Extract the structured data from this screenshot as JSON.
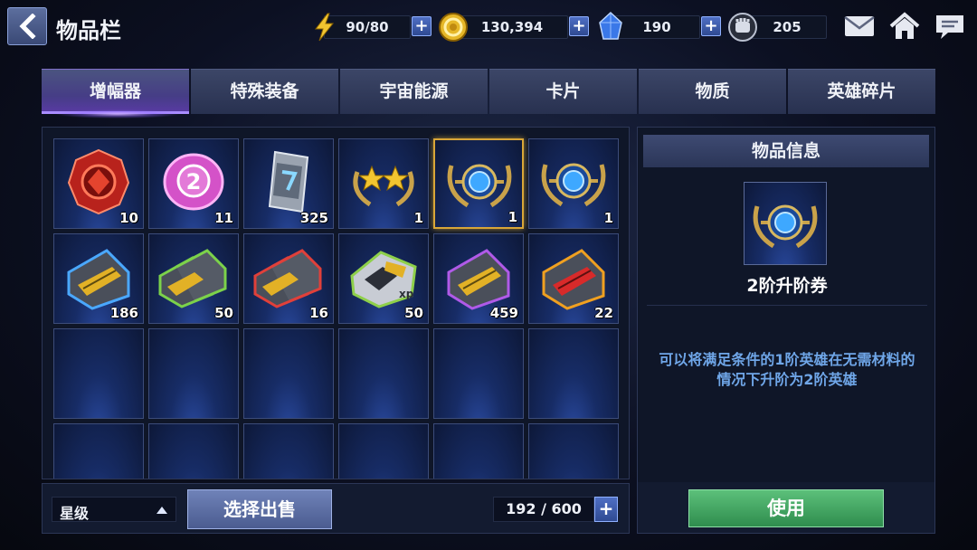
{
  "header": {
    "title": "物品栏"
  },
  "resources": {
    "energy": {
      "value": "90/80",
      "icon": "lightning-icon"
    },
    "gold": {
      "value": "130,394",
      "icon": "gold-coin-icon"
    },
    "crystal": {
      "value": "190",
      "icon": "blue-crystal-icon"
    },
    "stamina": {
      "value": "205",
      "icon": "fist-icon"
    },
    "plus_label": "+"
  },
  "top_icons": [
    "mail-icon",
    "home-icon",
    "chat-icon"
  ],
  "tabs": [
    {
      "label": "增幅器",
      "active": true
    },
    {
      "label": "特殊装备",
      "active": false
    },
    {
      "label": "宇宙能源",
      "active": false
    },
    {
      "label": "卡片",
      "active": false
    },
    {
      "label": "物质",
      "active": false
    },
    {
      "label": "英雄碎片",
      "active": false
    }
  ],
  "inventory": {
    "items": [
      {
        "icon": "red-gem-icon",
        "count": "10"
      },
      {
        "icon": "pink-coin-2-icon",
        "count": "11"
      },
      {
        "icon": "silver-ticket-icon",
        "count": "325"
      },
      {
        "icon": "two-star-laurel-icon",
        "count": "1"
      },
      {
        "icon": "blue-gem-laurel-icon",
        "count": "1",
        "selected": true
      },
      {
        "icon": "blue-gem-laurel-icon",
        "count": "1"
      },
      {
        "icon": "blue-card-chip-icon",
        "count": "186"
      },
      {
        "icon": "green-card-chip-double-icon",
        "count": "50"
      },
      {
        "icon": "red-card-chip-double-icon",
        "count": "16"
      },
      {
        "icon": "xp-chip-icon",
        "count": "50"
      },
      {
        "icon": "purple-card-chip-icon",
        "count": "459"
      },
      {
        "icon": "red-card-chip-icon",
        "count": "22"
      }
    ]
  },
  "bottom_bar": {
    "sort_label": "星级",
    "sell_label": "选择出售",
    "capacity": "192 / 600",
    "capacity_plus": "+"
  },
  "info_panel": {
    "header": "物品信息",
    "item_name": "2阶升阶券",
    "description": "可以将满足条件的1阶英雄在无需材料的情况下升阶为2阶英雄",
    "use_label": "使用"
  },
  "colors": {
    "tab_active": "#5a3aa6",
    "selected_border": "#d9a638",
    "use_button": "#3fa560",
    "desc_text": "#6fa6e8"
  }
}
